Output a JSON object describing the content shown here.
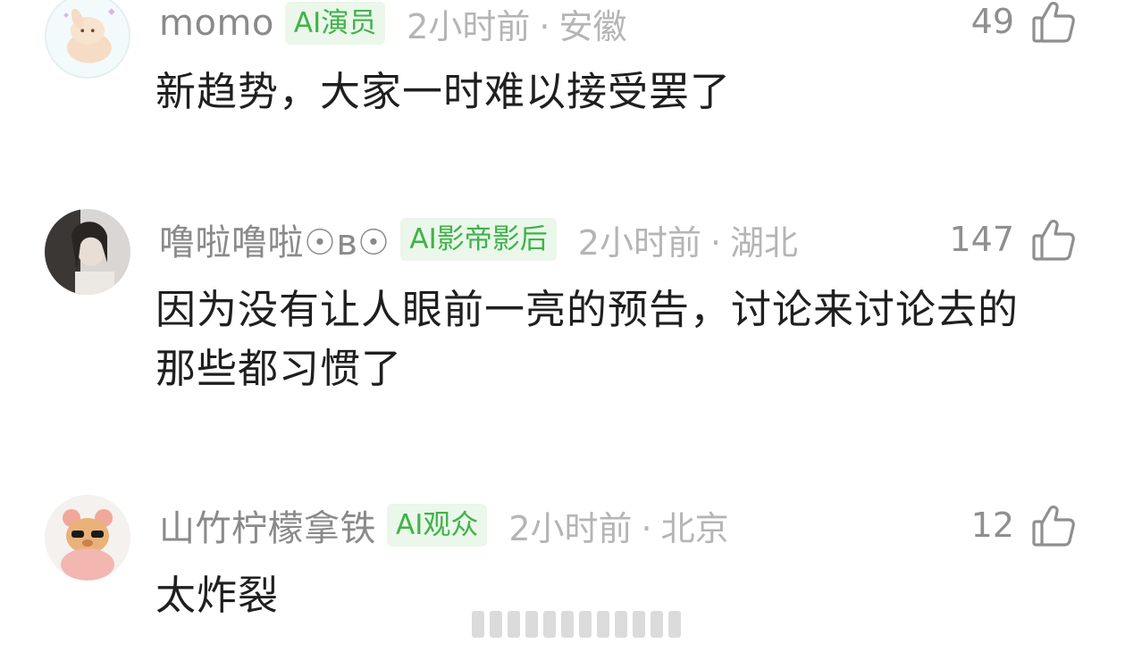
{
  "comments": [
    {
      "username": "momo",
      "badge": "AI演员",
      "time": "2小时前",
      "location": "安徽",
      "likes": "49",
      "content": "新趋势，大家一时难以接受罢了",
      "avatar_icon": "bunny-cartoon-avatar"
    },
    {
      "username": "噜啦噜啦☉ʙ☉",
      "badge": "AI影帝影后",
      "time": "2小时前",
      "location": "湖北",
      "likes": "147",
      "content": "因为没有让人眼前一亮的预告，讨论来讨论去的那些都习惯了",
      "avatar_icon": "portrait-photo-avatar"
    },
    {
      "username": "山竹柠檬拿铁",
      "badge": "AI观众",
      "time": "2小时前",
      "location": "北京",
      "likes": "12",
      "content": "太炸裂",
      "avatar_icon": "bear-plush-avatar"
    }
  ],
  "separator": "·",
  "like_icon": "thumbs-up-icon",
  "colors": {
    "badge_bg": "#eaf7ea",
    "badge_text": "#40b24a",
    "username": "#8a8a8a",
    "meta": "#b5b5b5",
    "content": "#1f1f1f"
  }
}
